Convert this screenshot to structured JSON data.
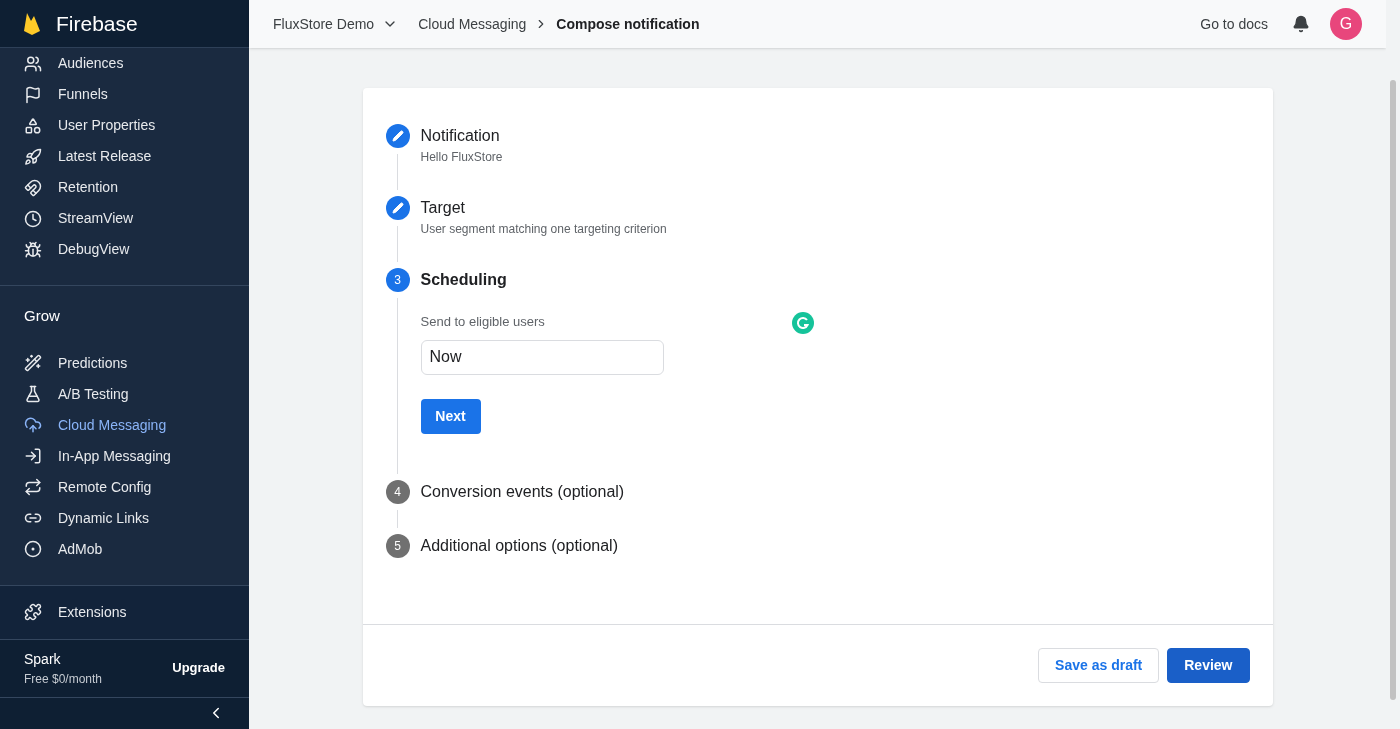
{
  "brand": "Firebase",
  "sidebar": {
    "items": [
      {
        "label": "Audiences",
        "selected": false
      },
      {
        "label": "Funnels",
        "selected": false
      },
      {
        "label": "User Properties",
        "selected": false
      },
      {
        "label": "Latest Release",
        "selected": false
      },
      {
        "label": "Retention",
        "selected": false
      },
      {
        "label": "StreamView",
        "selected": false
      },
      {
        "label": "DebugView",
        "selected": false
      }
    ],
    "section": {
      "title": "Grow",
      "items": [
        {
          "label": "Predictions",
          "selected": false
        },
        {
          "label": "A/B Testing",
          "selected": false
        },
        {
          "label": "Cloud Messaging",
          "selected": true
        },
        {
          "label": "In-App Messaging",
          "selected": false
        },
        {
          "label": "Remote Config",
          "selected": false
        },
        {
          "label": "Dynamic Links",
          "selected": false
        },
        {
          "label": "AdMob",
          "selected": false
        }
      ]
    },
    "extensions": {
      "label": "Extensions",
      "selected": false
    },
    "plan": {
      "name": "Spark",
      "price": "Free $0/month",
      "action": "Upgrade"
    }
  },
  "header": {
    "project": "FluxStore Demo",
    "breadcrumb": [
      "Cloud Messaging",
      "Compose notification"
    ],
    "docs_link": "Go to docs",
    "avatar": "G"
  },
  "steps": [
    {
      "kind": "done",
      "title": "Notification",
      "subtitle": "Hello FluxStore"
    },
    {
      "kind": "done",
      "title": "Target",
      "subtitle": "User segment matching one targeting criterion"
    },
    {
      "kind": "active",
      "number": "3",
      "title": "Scheduling",
      "field_label": "Send to eligible users",
      "field_value": "Now",
      "button": "Next"
    },
    {
      "kind": "pending",
      "number": "4",
      "title": "Conversion events (optional)"
    },
    {
      "kind": "pending",
      "number": "5",
      "title": "Additional options (optional)"
    }
  ],
  "footer": {
    "buttons": [
      {
        "label": "Save as draft",
        "kind": "secondary"
      },
      {
        "label": "Review",
        "kind": "primary"
      }
    ]
  }
}
